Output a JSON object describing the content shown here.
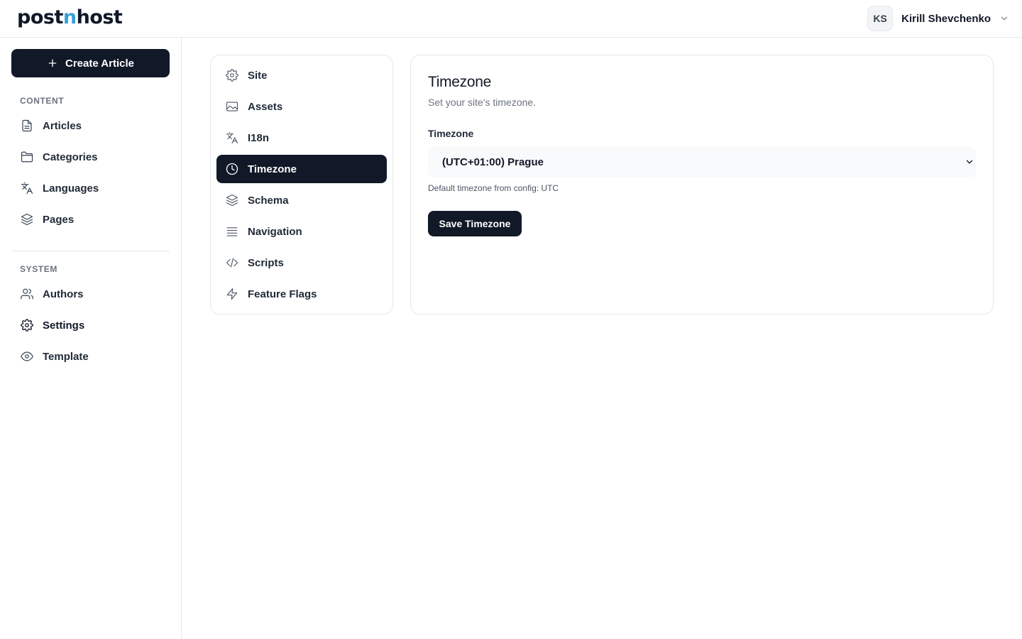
{
  "header": {
    "logo_pre": "post",
    "logo_accent": "n",
    "logo_post": "host",
    "user_initials": "KS",
    "user_name": "Kirill Shevchenko",
    "accent_color": "#3b9fd6"
  },
  "sidebar": {
    "create_label": "Create Article",
    "content_label": "CONTENT",
    "system_label": "SYSTEM",
    "content_items": [
      {
        "label": "Articles",
        "icon": "file-text-icon"
      },
      {
        "label": "Categories",
        "icon": "folder-icon"
      },
      {
        "label": "Languages",
        "icon": "languages-icon"
      },
      {
        "label": "Pages",
        "icon": "layers-icon"
      }
    ],
    "system_items": [
      {
        "label": "Authors",
        "icon": "users-icon"
      },
      {
        "label": "Settings",
        "icon": "gear-icon",
        "active": true
      },
      {
        "label": "Template",
        "icon": "eye-icon"
      }
    ]
  },
  "settings_menu": {
    "items": [
      {
        "label": "Site",
        "icon": "gear-icon"
      },
      {
        "label": "Assets",
        "icon": "image-icon"
      },
      {
        "label": "I18n",
        "icon": "languages-icon"
      },
      {
        "label": "Timezone",
        "icon": "clock-icon",
        "active": true
      },
      {
        "label": "Schema",
        "icon": "layers-icon"
      },
      {
        "label": "Navigation",
        "icon": "menu-lines-icon"
      },
      {
        "label": "Scripts",
        "icon": "code-icon"
      },
      {
        "label": "Feature Flags",
        "icon": "lightning-icon"
      }
    ]
  },
  "timezone": {
    "title": "Timezone",
    "description": "Set your site's timezone.",
    "field_label": "Timezone",
    "selected_value": "(UTC+01:00) Prague",
    "hint": "Default timezone from config: UTC",
    "save_label": "Save Timezone"
  }
}
